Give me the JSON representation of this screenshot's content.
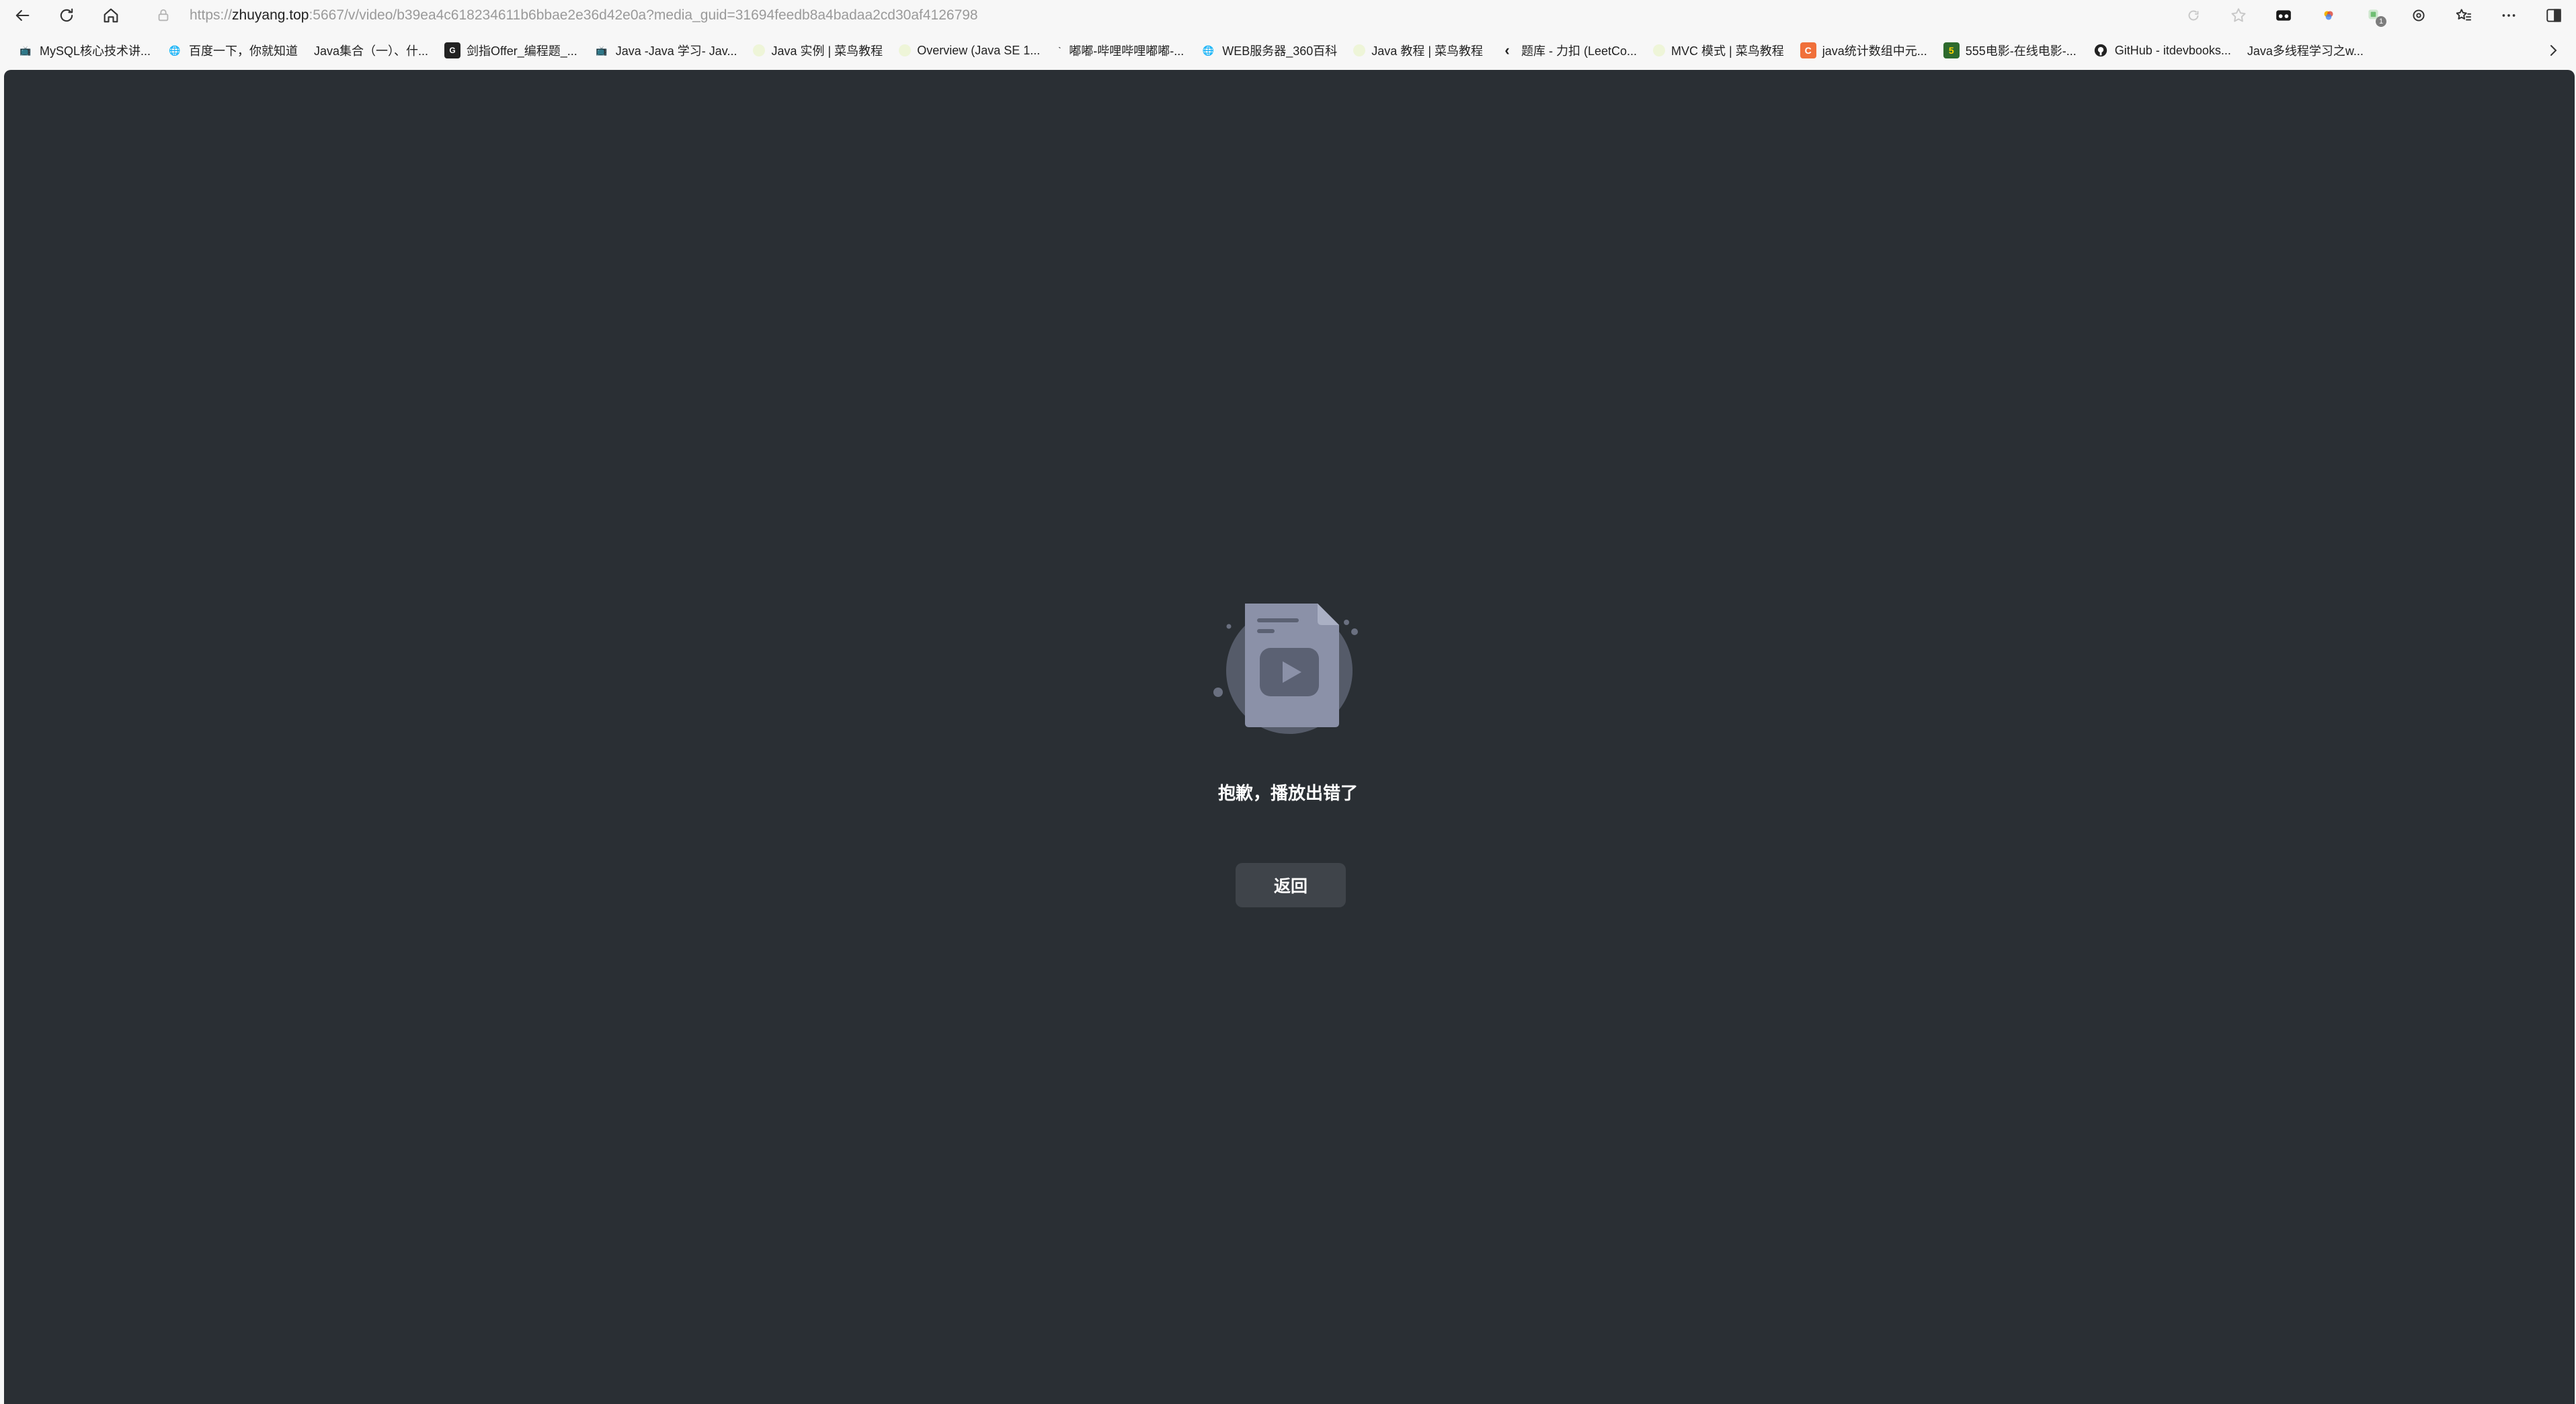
{
  "browser": {
    "url_scheme": "https://",
    "url_host": "zhuyang.top",
    "url_rest": ":5667/v/video/b39ea4c618234611b6bbae2e36d42e0a?media_guid=31694feedb8a4badaa2cd30af4126798",
    "extension_badge_count": "1"
  },
  "bookmarks": [
    {
      "label": "MySQL核心技术讲...",
      "icon": "tv-icon"
    },
    {
      "label": "百度一下，你就知道",
      "icon": "globe-icon"
    },
    {
      "label": "Java集合（一）、什...",
      "icon": "blank"
    },
    {
      "label": "剑指Offer_编程题_...",
      "icon": "nowcoder-icon"
    },
    {
      "label": "Java -Java 学习- Jav...",
      "icon": "tv-icon"
    },
    {
      "label": "Java 实例 | 菜鸟教程",
      "icon": "runoob-icon"
    },
    {
      "label": "Overview (Java SE 1...",
      "icon": "runoob-icon"
    },
    {
      "label": "嘟嘟-哔哩哔哩嘟嘟-...",
      "icon": "tick-icon"
    },
    {
      "label": "WEB服务器_360百科",
      "icon": "globe-icon"
    },
    {
      "label": "Java 教程 | 菜鸟教程",
      "icon": "runoob-icon"
    },
    {
      "label": "题库 - 力扣 (LeetCo...",
      "icon": "leetcode-icon"
    },
    {
      "label": "MVC 模式 | 菜鸟教程",
      "icon": "runoob-icon"
    },
    {
      "label": "java统计数组中元...",
      "icon": "csdn-icon"
    },
    {
      "label": "555电影-在线电影-...",
      "icon": "555-icon"
    },
    {
      "label": "GitHub - itdevbooks...",
      "icon": "github-icon"
    },
    {
      "label": "Java多线程学习之w...",
      "icon": "blank"
    }
  ],
  "player": {
    "error_message": "抱歉，播放出错了",
    "back_label": "返回"
  },
  "colors": {
    "player_bg": "#2a2f34",
    "button_bg": "#3f444a",
    "illustration_circle": "#555b69",
    "illustration_doc": "#8b91a8"
  }
}
